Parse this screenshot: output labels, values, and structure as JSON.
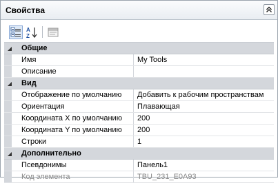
{
  "panel": {
    "title": "Свойства"
  },
  "categories": [
    {
      "label": "Общие",
      "rows": [
        {
          "name": "Имя",
          "value": "My Tools"
        },
        {
          "name": "Описание",
          "value": ""
        }
      ]
    },
    {
      "label": "Вид",
      "rows": [
        {
          "name": "Отображение по умолчанию",
          "value": "Добавить к рабочим пространствам"
        },
        {
          "name": "Ориентация",
          "value": "Плавающая"
        },
        {
          "name": "Координата X по умолчанию",
          "value": "200"
        },
        {
          "name": "Координата Y по умолчанию",
          "value": "200"
        },
        {
          "name": "Строки",
          "value": "1"
        }
      ]
    },
    {
      "label": "Дополнительно",
      "rows": [
        {
          "name": "Псевдонимы",
          "value": "Панель1"
        },
        {
          "name": "Код элемента",
          "value": "TBU_231_E0A93"
        }
      ]
    }
  ],
  "colors": {
    "category_bg": "#d4d7dc",
    "active_button": "#dce8f7",
    "disabled_text": "#8a8a8a"
  }
}
